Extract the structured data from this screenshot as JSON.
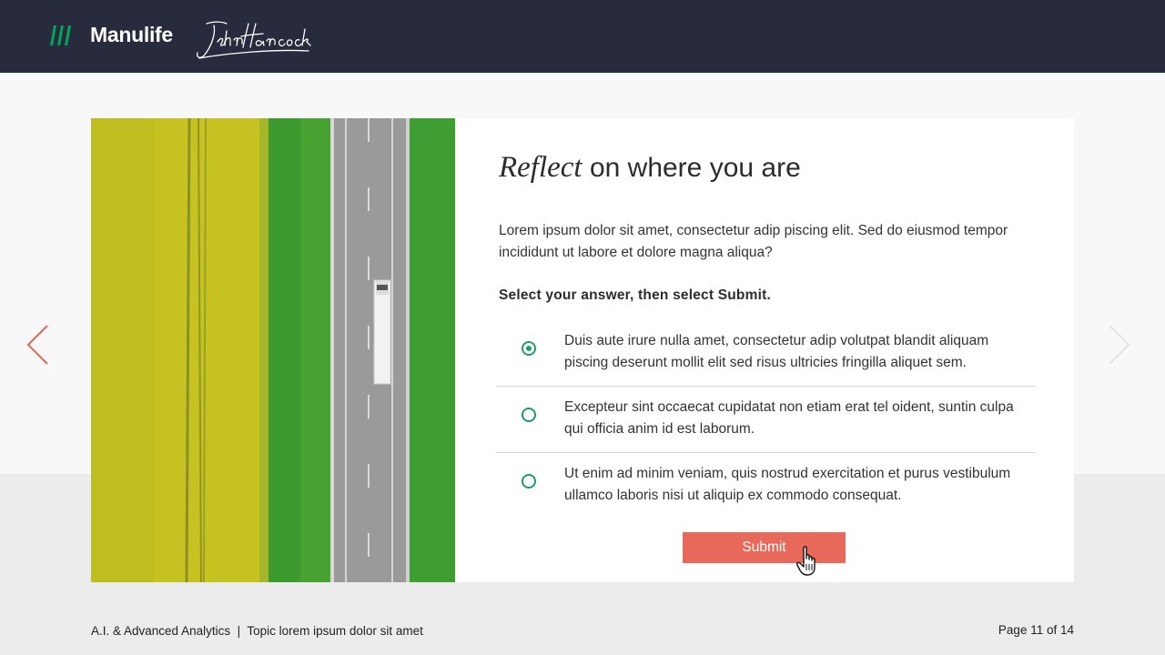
{
  "header": {
    "brand_name": "Manulife",
    "brand_color": "#00a758",
    "signature_logo": "John Hancock"
  },
  "photo": {
    "icon": "aerial-road-field-photo"
  },
  "question": {
    "title_emphasis": "Reflect",
    "title_rest": " on where you are",
    "intro": "Lorem ipsum dolor sit amet, consectetur adip piscing elit. Sed do eiusmod tempor incididunt ut labore et dolore magna aliqua?",
    "instruction": "Select your answer, then select Submit.",
    "options": [
      {
        "label": "Duis aute irure nulla amet, consectetur adip volutpat blandit aliquam piscing deserunt mollit elit sed risus ultricies fringilla aliquet sem.",
        "selected": true
      },
      {
        "label": "Excepteur sint occaecat cupidatat non etiam erat tel oident, suntin culpa qui officia anim id est laborum.",
        "selected": false
      },
      {
        "label": "Ut enim ad minim veniam, quis nostrud exercitation et purus vestibulum ullamco laboris nisi ut aliquip ex commodo consequat.",
        "selected": false
      }
    ],
    "submit_label": "Submit",
    "accent_color": "#e8685a",
    "radio_color": "#1f9a6a"
  },
  "nav": {
    "prev_icon": "chevron-left-icon",
    "next_icon": "chevron-right-icon"
  },
  "footer": {
    "course": "A.I. & Advanced Analytics  |  Topic lorem ipsum dolor sit amet",
    "page": "Page 11 of 14"
  }
}
